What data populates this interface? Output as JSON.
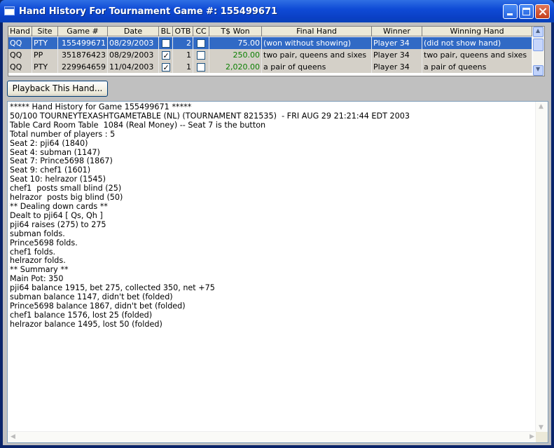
{
  "window": {
    "title": "Hand History For Tournament Game #: 155499671"
  },
  "columns": [
    "Hand",
    "Site",
    "Game #",
    "Date",
    "BL",
    "OTB",
    "CC",
    "T$ Won",
    "Final Hand",
    "Winner",
    "Winning Hand"
  ],
  "rows": [
    {
      "hand": "QQ",
      "site": "PTY",
      "game": "155499671",
      "date": "08/29/2003",
      "bl": false,
      "otb": "2",
      "cc": false,
      "won": "75.00",
      "final_hand": "(won without showing)",
      "winner": "Player 34",
      "winning_hand": "(did not show hand)",
      "selected": true
    },
    {
      "hand": "QQ",
      "site": "PP",
      "game": "351876423",
      "date": "08/29/2003",
      "bl": true,
      "otb": "1",
      "cc": false,
      "won": "250.00",
      "final_hand": "two pair, queens and sixes",
      "winner": "Player 34",
      "winning_hand": "two pair, queens and sixes",
      "selected": false
    },
    {
      "hand": "QQ",
      "site": "PTY",
      "game": "229964659",
      "date": "11/04/2003",
      "bl": true,
      "otb": "1",
      "cc": false,
      "won": "2,020.00",
      "final_hand": "a pair of queens",
      "winner": "Player 34",
      "winning_hand": "a pair of queens",
      "selected": false
    }
  ],
  "playback_button": {
    "label": "Playback This Hand..."
  },
  "history_lines": [
    "***** Hand History for Game 155499671 *****",
    "50/100 TOURNEYTEXASHTGAMETABLE (NL) (TOURNAMENT 821535)  - FRI AUG 29 21:21:44 EDT 2003",
    "Table Card Room Table  1084 (Real Money) -- Seat 7 is the button",
    "Total number of players : 5",
    "Seat 2: pji64 (1840)",
    "Seat 4: subman (1147)",
    "Seat 7: Prince5698 (1867)",
    "Seat 9: chef1 (1601)",
    "Seat 10: helrazor (1545)",
    "chef1  posts small blind (25)",
    "helrazor  posts big blind (50)",
    "** Dealing down cards **",
    "Dealt to pji64 [ Qs, Qh ]",
    "pji64 raises (275) to 275",
    "subman folds.",
    "Prince5698 folds.",
    "chef1 folds.",
    "helrazor folds.",
    "** Summary **",
    "Main Pot: 350",
    "pji64 balance 1915, bet 275, collected 350, net +75",
    "subman balance 1147, didn't bet (folded)",
    "Prince5698 balance 1867, didn't bet (folded)",
    "chef1 balance 1576, lost 25 (folded)",
    "helrazor balance 1495, lost 50 (folded)"
  ],
  "colors": {
    "selection": "#316ac5",
    "won_green": "#0a7f00"
  },
  "icons": {
    "title": "window-app-icon",
    "minimize": "minimize-icon",
    "maximize": "maximize-icon",
    "close": "close-icon"
  }
}
